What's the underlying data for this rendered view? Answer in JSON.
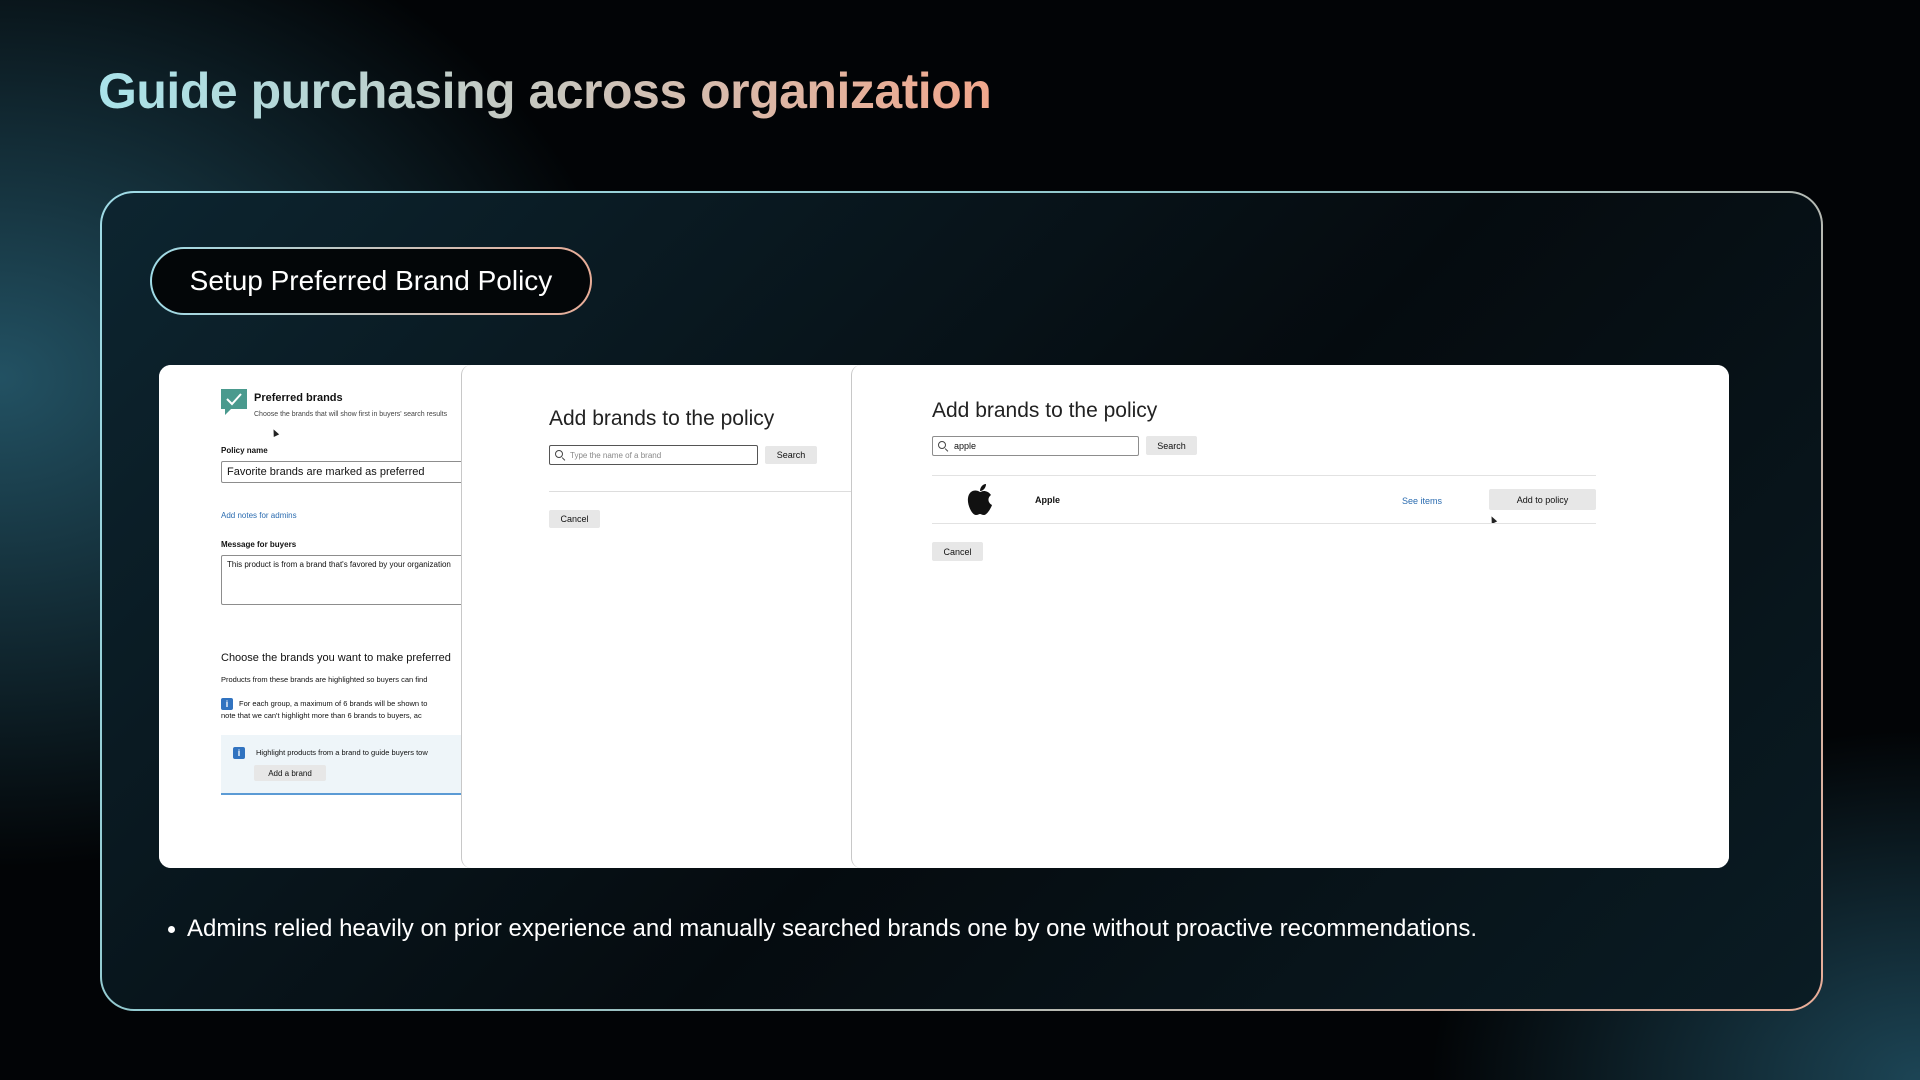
{
  "slide": {
    "title": "Guide purchasing across organization",
    "pill_label": "Setup Preferred Brand Policy",
    "bullet": "Admins relied heavily on prior experience and manually searched brands one by one without proactive recommendations."
  },
  "panel1": {
    "header_title": "Preferred brands",
    "header_subtitle": "Choose the brands that will show first in buyers' search results",
    "policy_name_label": "Policy name",
    "policy_name_value": "Favorite brands are marked as preferred",
    "add_notes_link": "Add notes for admins",
    "message_label": "Message for buyers",
    "message_value": "This product is from a brand that's favored by your organization",
    "choose_heading": "Choose the brands you want to make preferred",
    "choose_desc": "Products from these brands are highlighted so buyers can find",
    "info_line1": "For each group, a maximum of 6 brands will be shown to",
    "info_line2": "note that we can't highlight more than 6 brands to buyers, ac",
    "highlight_text": "Highlight products from a brand to guide buyers tow",
    "add_brand_button": "Add a brand"
  },
  "panel2": {
    "title": "Add brands to the policy",
    "search_placeholder": "Type the name of a brand",
    "search_button": "Search",
    "cancel_button": "Cancel"
  },
  "panel3": {
    "title": "Add brands to the policy",
    "search_value": "apple",
    "search_button": "Search",
    "result_brand": "Apple",
    "see_items_link": "See items",
    "add_to_policy_button": "Add to policy",
    "cancel_button": "Cancel"
  },
  "colors": {
    "title_gradient_start": "#a9e3ea",
    "title_gradient_end": "#f1a78c",
    "link_blue": "#2b6cb0",
    "check_green": "#4a9a8e"
  },
  "icons": {
    "check": "checkmark-badge-icon",
    "search": "search-icon",
    "info": "info-icon",
    "apple": "apple-logo-icon",
    "bullet": "bullet-dot"
  }
}
